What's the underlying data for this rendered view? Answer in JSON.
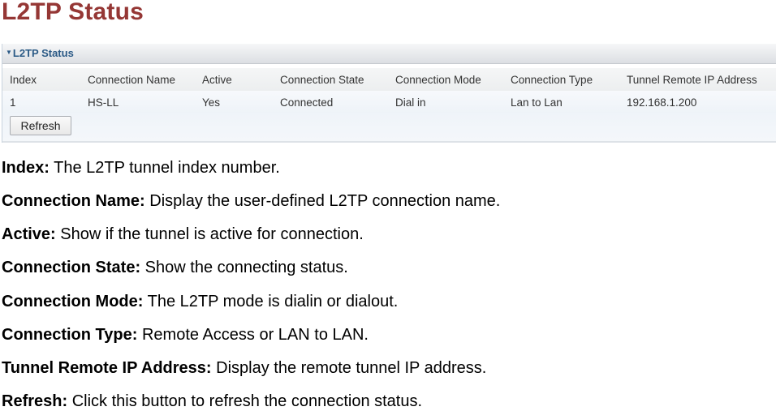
{
  "page": {
    "title": "L2TP Status"
  },
  "panel": {
    "title": "L2TP Status",
    "collapse_icon": "triangle-down-icon",
    "columns": [
      "Index",
      "Connection Name",
      "Active",
      "Connection State",
      "Connection Mode",
      "Connection Type",
      "Tunnel Remote IP Address"
    ],
    "rows": [
      [
        "1",
        "HS-LL",
        "Yes",
        "Connected",
        "Dial in",
        "Lan to Lan",
        "192.168.1.200"
      ]
    ],
    "refresh_label": "Refresh"
  },
  "descriptions": [
    {
      "term": "Index:",
      "text": " The L2TP tunnel index number."
    },
    {
      "term": "Connection Name:",
      "text": " Display the user-defined L2TP connection name."
    },
    {
      "term": "Active:",
      "text": " Show if the tunnel is active for connection."
    },
    {
      "term": "Connection State:",
      "text": " Show the connecting status."
    },
    {
      "term": "Connection Mode:",
      "text": " The L2TP mode is dialin or dialout."
    },
    {
      "term": "Connection Type:",
      "text": " Remote Access or LAN to LAN."
    },
    {
      "term": "Tunnel Remote IP Address:",
      "text": " Display the remote tunnel IP address."
    },
    {
      "term": "Refresh:",
      "text": " Click this button to refresh the connection status."
    }
  ]
}
